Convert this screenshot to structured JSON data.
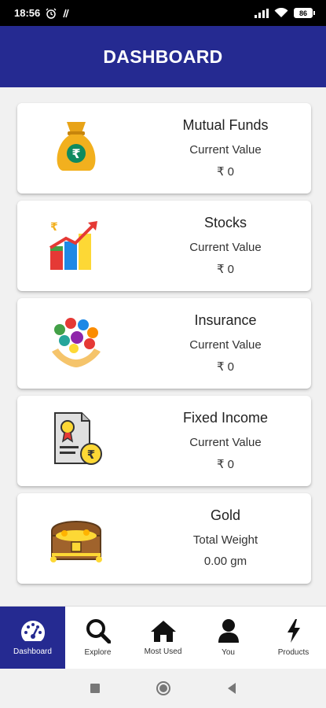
{
  "status": {
    "time": "18:56",
    "battery": "86"
  },
  "header": {
    "title": "DASHBOARD"
  },
  "cards": [
    {
      "title": "Mutual Funds",
      "subtitle": "Current Value",
      "value": "₹ 0",
      "icon": "money-bag-icon"
    },
    {
      "title": "Stocks",
      "subtitle": "Current Value",
      "value": "₹ 0",
      "icon": "bar-chart-growth-icon"
    },
    {
      "title": "Insurance",
      "subtitle": "Current Value",
      "value": "₹ 0",
      "icon": "insurance-hands-icon"
    },
    {
      "title": "Fixed Income",
      "subtitle": "Current Value",
      "value": "₹ 0",
      "icon": "certificate-rupee-icon"
    },
    {
      "title": "Gold",
      "subtitle": "Total Weight",
      "value": "0.00 gm",
      "icon": "treasure-chest-icon"
    }
  ],
  "nav": [
    {
      "label": "Dashboard",
      "icon": "speedometer-icon",
      "active": true
    },
    {
      "label": "Explore",
      "icon": "search-icon",
      "active": false
    },
    {
      "label": "Most Used",
      "icon": "home-icon",
      "active": false
    },
    {
      "label": "You",
      "icon": "user-icon",
      "active": false
    },
    {
      "label": "Products",
      "icon": "lightning-icon",
      "active": false
    }
  ],
  "colors": {
    "primary": "#252a91",
    "background": "#f1f1f1",
    "card": "#ffffff"
  }
}
